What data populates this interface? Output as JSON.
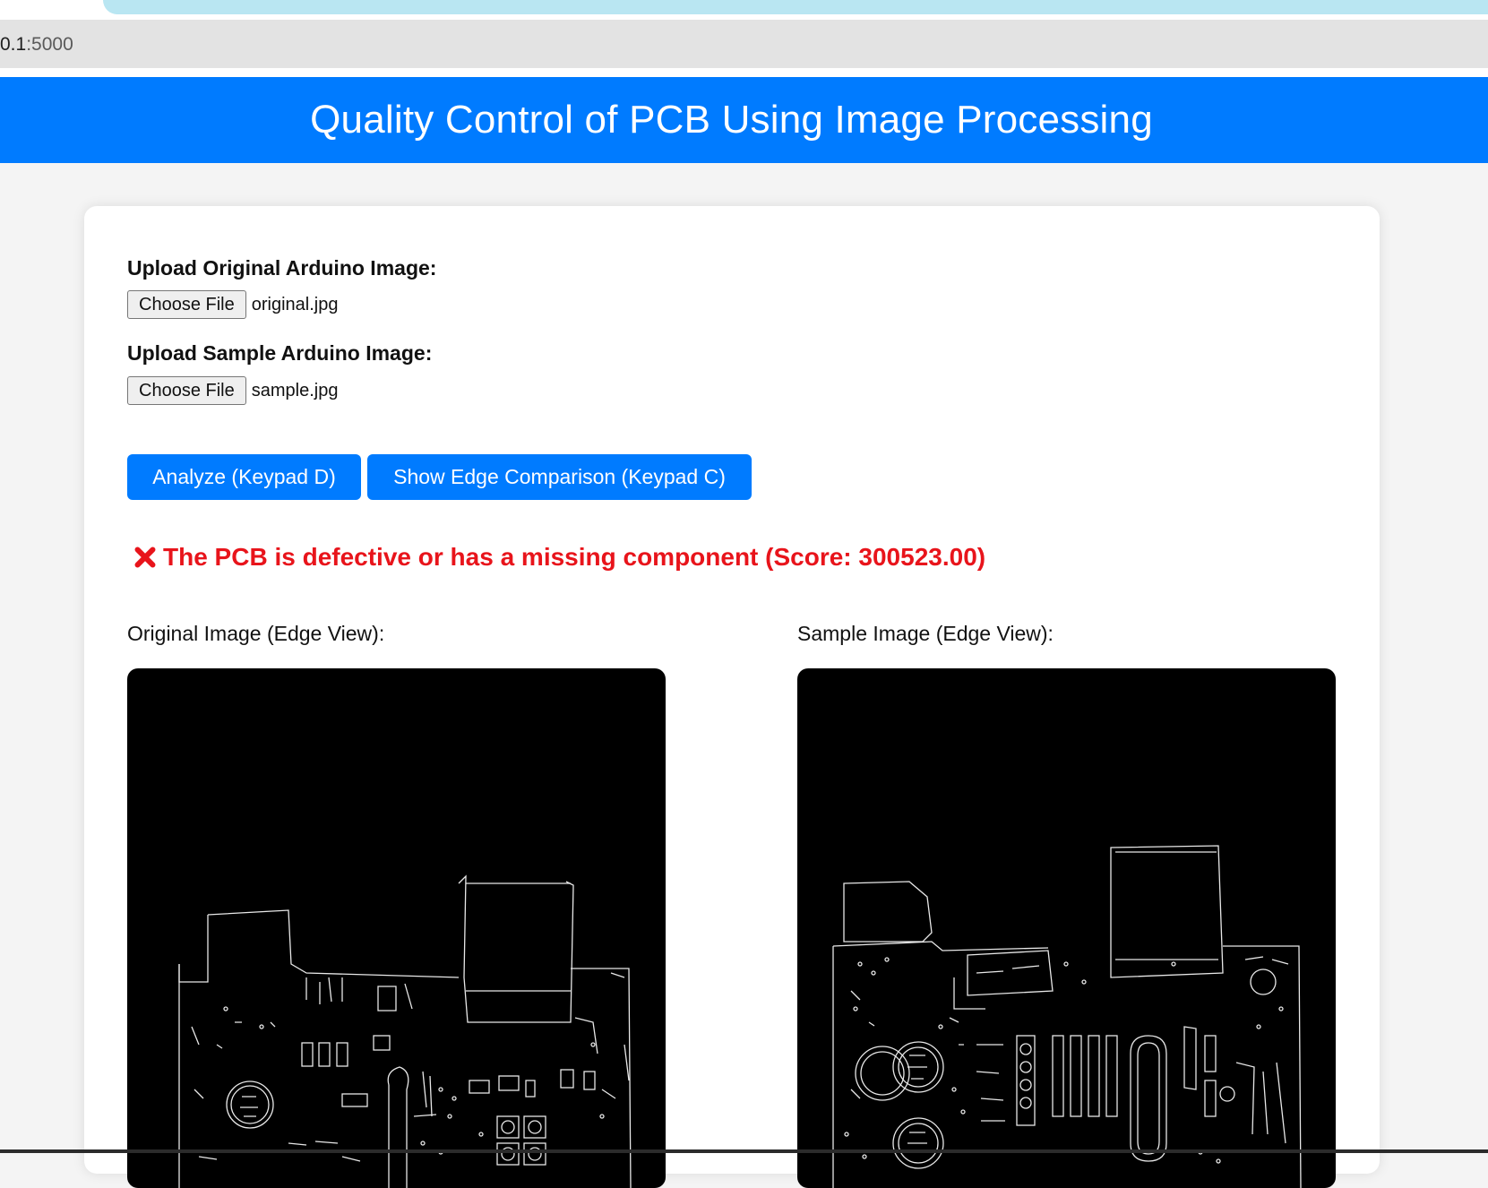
{
  "browser": {
    "url_host": "0.1",
    "url_port": ":5000"
  },
  "header": {
    "title": "Quality Control of PCB Using Image Processing"
  },
  "form": {
    "original": {
      "label": "Upload Original Arduino Image:",
      "button_label": "Choose File",
      "file_name": "original.jpg"
    },
    "sample": {
      "label": "Upload Sample Arduino Image:",
      "button_label": "Choose File",
      "file_name": "sample.jpg"
    },
    "analyze_label": "Analyze (Keypad D)",
    "compare_label": "Show Edge Comparison (Keypad C)"
  },
  "result": {
    "icon": "cross-mark-icon",
    "text": "The PCB is defective or has a missing component (Score: 300523.00)",
    "color": "#e8141b"
  },
  "views": {
    "original_label": "Original Image (Edge View):",
    "sample_label": "Sample Image (Edge View):"
  },
  "colors": {
    "accent": "#007bff",
    "page_background": "#f4f4f4",
    "edge_background": "#000000"
  }
}
